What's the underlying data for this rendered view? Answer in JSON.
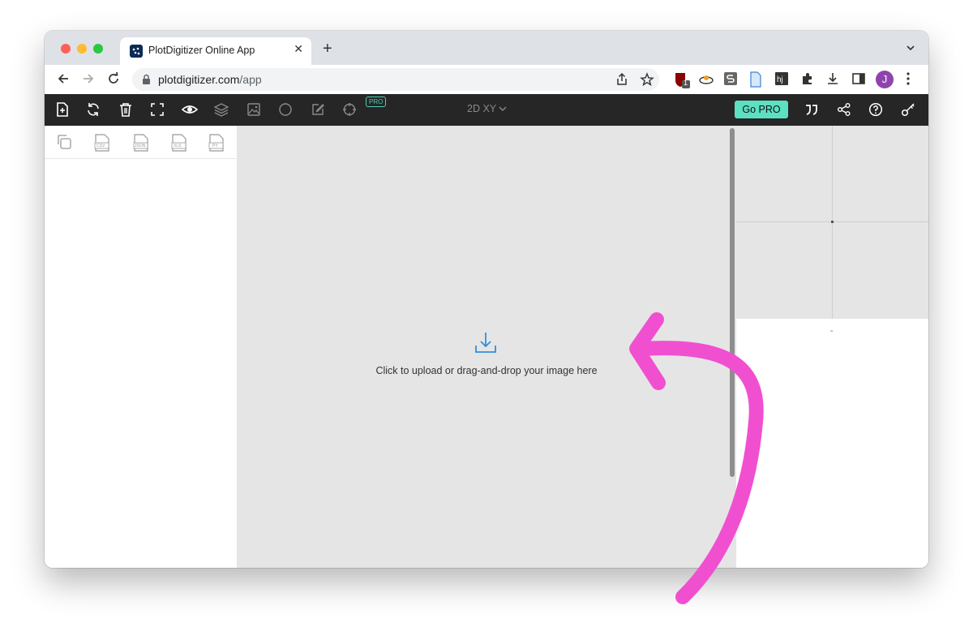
{
  "browser": {
    "tab_title": "PlotDigitizer Online App",
    "tab_close": "✕",
    "new_tab": "+",
    "url_host": "plotdigitizer.com",
    "url_path": "/app",
    "extension_badge": "1",
    "profile_initial": "J"
  },
  "toolbar": {
    "pro_badge": "PRO",
    "mode_label": "2D XY",
    "go_pro_label": "Go PRO"
  },
  "export": {
    "formats": [
      "CSV",
      "JSON",
      "XLS",
      "PY"
    ]
  },
  "canvas": {
    "upload_text": "Click to upload or drag-and-drop your image here"
  },
  "magnifier": {
    "readout": "-"
  },
  "colors": {
    "toolbar_bg": "#262626",
    "accent": "#5ce0c2",
    "upload_icon": "#2f8fe0",
    "annotation_arrow": "#f050d0"
  }
}
